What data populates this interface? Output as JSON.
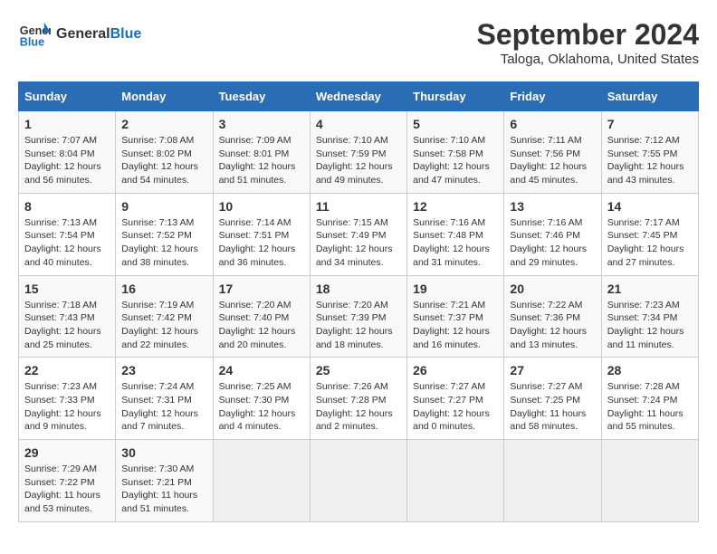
{
  "header": {
    "logo_line1": "General",
    "logo_line2": "Blue",
    "title": "September 2024",
    "subtitle": "Taloga, Oklahoma, United States"
  },
  "calendar": {
    "days_of_week": [
      "Sunday",
      "Monday",
      "Tuesday",
      "Wednesday",
      "Thursday",
      "Friday",
      "Saturday"
    ],
    "weeks": [
      [
        {
          "day": "",
          "info": ""
        },
        {
          "day": "2",
          "info": "Sunrise: 7:08 AM\nSunset: 8:02 PM\nDaylight: 12 hours\nand 54 minutes."
        },
        {
          "day": "3",
          "info": "Sunrise: 7:09 AM\nSunset: 8:01 PM\nDaylight: 12 hours\nand 51 minutes."
        },
        {
          "day": "4",
          "info": "Sunrise: 7:10 AM\nSunset: 7:59 PM\nDaylight: 12 hours\nand 49 minutes."
        },
        {
          "day": "5",
          "info": "Sunrise: 7:10 AM\nSunset: 7:58 PM\nDaylight: 12 hours\nand 47 minutes."
        },
        {
          "day": "6",
          "info": "Sunrise: 7:11 AM\nSunset: 7:56 PM\nDaylight: 12 hours\nand 45 minutes."
        },
        {
          "day": "7",
          "info": "Sunrise: 7:12 AM\nSunset: 7:55 PM\nDaylight: 12 hours\nand 43 minutes."
        }
      ],
      [
        {
          "day": "8",
          "info": "Sunrise: 7:13 AM\nSunset: 7:54 PM\nDaylight: 12 hours\nand 40 minutes."
        },
        {
          "day": "9",
          "info": "Sunrise: 7:13 AM\nSunset: 7:52 PM\nDaylight: 12 hours\nand 38 minutes."
        },
        {
          "day": "10",
          "info": "Sunrise: 7:14 AM\nSunset: 7:51 PM\nDaylight: 12 hours\nand 36 minutes."
        },
        {
          "day": "11",
          "info": "Sunrise: 7:15 AM\nSunset: 7:49 PM\nDaylight: 12 hours\nand 34 minutes."
        },
        {
          "day": "12",
          "info": "Sunrise: 7:16 AM\nSunset: 7:48 PM\nDaylight: 12 hours\nand 31 minutes."
        },
        {
          "day": "13",
          "info": "Sunrise: 7:16 AM\nSunset: 7:46 PM\nDaylight: 12 hours\nand 29 minutes."
        },
        {
          "day": "14",
          "info": "Sunrise: 7:17 AM\nSunset: 7:45 PM\nDaylight: 12 hours\nand 27 minutes."
        }
      ],
      [
        {
          "day": "15",
          "info": "Sunrise: 7:18 AM\nSunset: 7:43 PM\nDaylight: 12 hours\nand 25 minutes."
        },
        {
          "day": "16",
          "info": "Sunrise: 7:19 AM\nSunset: 7:42 PM\nDaylight: 12 hours\nand 22 minutes."
        },
        {
          "day": "17",
          "info": "Sunrise: 7:20 AM\nSunset: 7:40 PM\nDaylight: 12 hours\nand 20 minutes."
        },
        {
          "day": "18",
          "info": "Sunrise: 7:20 AM\nSunset: 7:39 PM\nDaylight: 12 hours\nand 18 minutes."
        },
        {
          "day": "19",
          "info": "Sunrise: 7:21 AM\nSunset: 7:37 PM\nDaylight: 12 hours\nand 16 minutes."
        },
        {
          "day": "20",
          "info": "Sunrise: 7:22 AM\nSunset: 7:36 PM\nDaylight: 12 hours\nand 13 minutes."
        },
        {
          "day": "21",
          "info": "Sunrise: 7:23 AM\nSunset: 7:34 PM\nDaylight: 12 hours\nand 11 minutes."
        }
      ],
      [
        {
          "day": "22",
          "info": "Sunrise: 7:23 AM\nSunset: 7:33 PM\nDaylight: 12 hours\nand 9 minutes."
        },
        {
          "day": "23",
          "info": "Sunrise: 7:24 AM\nSunset: 7:31 PM\nDaylight: 12 hours\nand 7 minutes."
        },
        {
          "day": "24",
          "info": "Sunrise: 7:25 AM\nSunset: 7:30 PM\nDaylight: 12 hours\nand 4 minutes."
        },
        {
          "day": "25",
          "info": "Sunrise: 7:26 AM\nSunset: 7:28 PM\nDaylight: 12 hours\nand 2 minutes."
        },
        {
          "day": "26",
          "info": "Sunrise: 7:27 AM\nSunset: 7:27 PM\nDaylight: 12 hours\nand 0 minutes."
        },
        {
          "day": "27",
          "info": "Sunrise: 7:27 AM\nSunset: 7:25 PM\nDaylight: 11 hours\nand 58 minutes."
        },
        {
          "day": "28",
          "info": "Sunrise: 7:28 AM\nSunset: 7:24 PM\nDaylight: 11 hours\nand 55 minutes."
        }
      ],
      [
        {
          "day": "29",
          "info": "Sunrise: 7:29 AM\nSunset: 7:22 PM\nDaylight: 11 hours\nand 53 minutes."
        },
        {
          "day": "30",
          "info": "Sunrise: 7:30 AM\nSunset: 7:21 PM\nDaylight: 11 hours\nand 51 minutes."
        },
        {
          "day": "",
          "info": ""
        },
        {
          "day": "",
          "info": ""
        },
        {
          "day": "",
          "info": ""
        },
        {
          "day": "",
          "info": ""
        },
        {
          "day": "",
          "info": ""
        }
      ]
    ],
    "week1_day1": {
      "day": "1",
      "info": "Sunrise: 7:07 AM\nSunset: 8:04 PM\nDaylight: 12 hours\nand 56 minutes."
    }
  }
}
